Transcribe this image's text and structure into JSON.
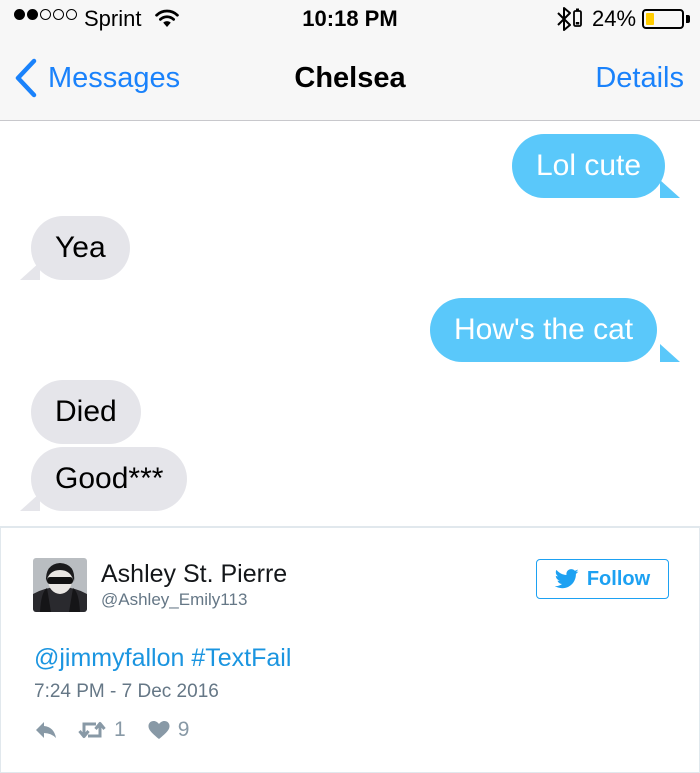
{
  "status_bar": {
    "carrier": "Sprint",
    "time": "10:18 PM",
    "battery_percent": "24%",
    "battery_level": 0.24,
    "signal_bars_filled": 2,
    "signal_bars_total": 5,
    "icons": [
      "signal-dots-icon",
      "wifi-icon",
      "bluetooth-icon",
      "battery-icon"
    ]
  },
  "nav": {
    "back_label": "Messages",
    "title": "Chelsea",
    "details_label": "Details",
    "accent_color": "#1a82fb"
  },
  "messages": [
    {
      "direction": "outgoing",
      "text": "Lol cute"
    },
    {
      "direction": "incoming",
      "text": "Yea"
    },
    {
      "direction": "outgoing",
      "text": "How's the cat"
    },
    {
      "direction": "incoming",
      "text": "Died"
    },
    {
      "direction": "incoming",
      "text": "Good***"
    }
  ],
  "colors": {
    "outgoing_bubble": "#5ac8fa",
    "incoming_bubble": "#e5e5ea",
    "twitter_blue": "#1da1f2"
  },
  "tweet": {
    "author_name": "Ashley St. Pierre",
    "author_handle": "@Ashley_Emily113",
    "follow_label": "Follow",
    "mention": "@jimmyfallon",
    "hashtag": "#TextFail",
    "timestamp": "7:24 PM - 7 Dec 2016",
    "retweets": "1",
    "likes": "9"
  }
}
